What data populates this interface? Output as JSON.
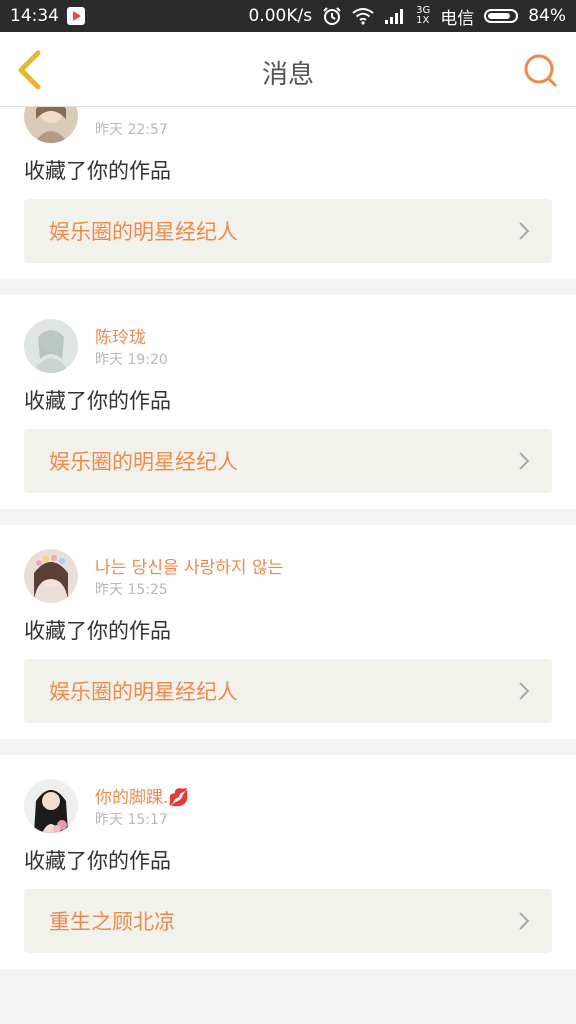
{
  "status_bar": {
    "time": "14:34",
    "net_speed": "0.00K/s",
    "net_type_top": "3G",
    "net_type_bottom": "1X",
    "carrier": "电信",
    "battery": "84%",
    "battery_level": 0.84
  },
  "header": {
    "title": "消息",
    "back_icon": "chevron-left-icon",
    "search_icon": "search-icon",
    "accent_color": "#f08a4b"
  },
  "messages": [
    {
      "name": "",
      "time": "昨天 22:57",
      "action": "收藏了你的作品",
      "work": "娱乐圈的明星经纪人"
    },
    {
      "name": "陈玲珑",
      "time": "昨天 19:20",
      "action": "收藏了你的作品",
      "work": "娱乐圈的明星经纪人"
    },
    {
      "name": "나는 당신을 사랑하지 않는",
      "time": "昨天 15:25",
      "action": "收藏了你的作品",
      "work": "娱乐圈的明星经纪人"
    },
    {
      "name": "你的脚踝.💋",
      "time": "昨天 15:17",
      "action": "收藏了你的作品",
      "work": "重生之顾北凉"
    }
  ]
}
